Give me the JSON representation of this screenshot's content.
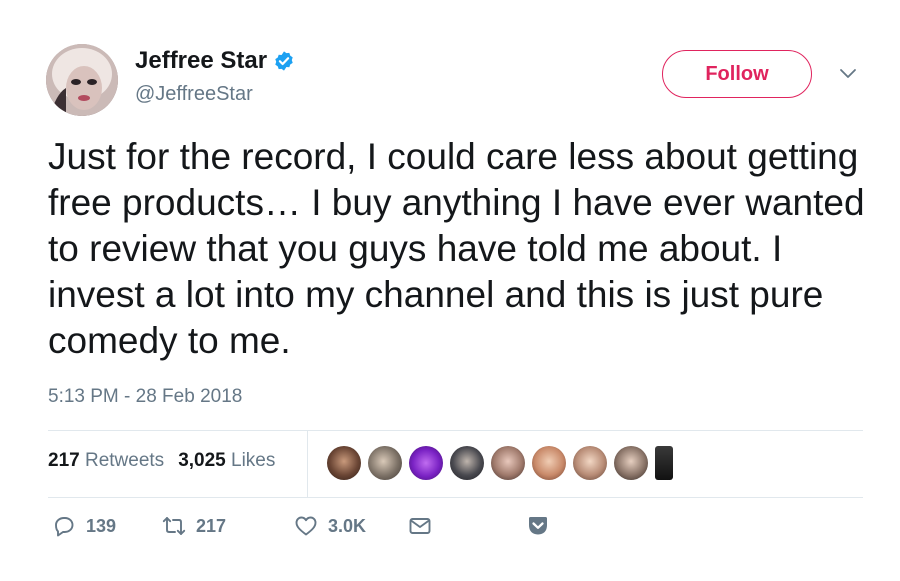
{
  "author": {
    "display_name": "Jeffree Star",
    "handle": "@JeffreeStar",
    "avatar_icon": "profile-avatar",
    "verified_icon": "verified-badge-icon"
  },
  "follow_button": {
    "label": "Follow"
  },
  "tweet": {
    "text": "Just for the record, I could care less about getting free products… I buy anything I have ever wanted to review that you guys have told me about. I invest a lot into my channel and this is just pure comedy to me.",
    "timestamp": "5:13 PM - 28 Feb 2018"
  },
  "stats": {
    "retweets_count": "217",
    "retweets_label": "Retweets",
    "likes_count": "3,025",
    "likes_label": "Likes"
  },
  "actions": {
    "reply_count": "139",
    "retweet_count": "217",
    "like_count": "3.0K"
  },
  "colors": {
    "accent": "#e0245e",
    "verified": "#1da1f2",
    "muted": "#657786",
    "text": "#14171a"
  }
}
